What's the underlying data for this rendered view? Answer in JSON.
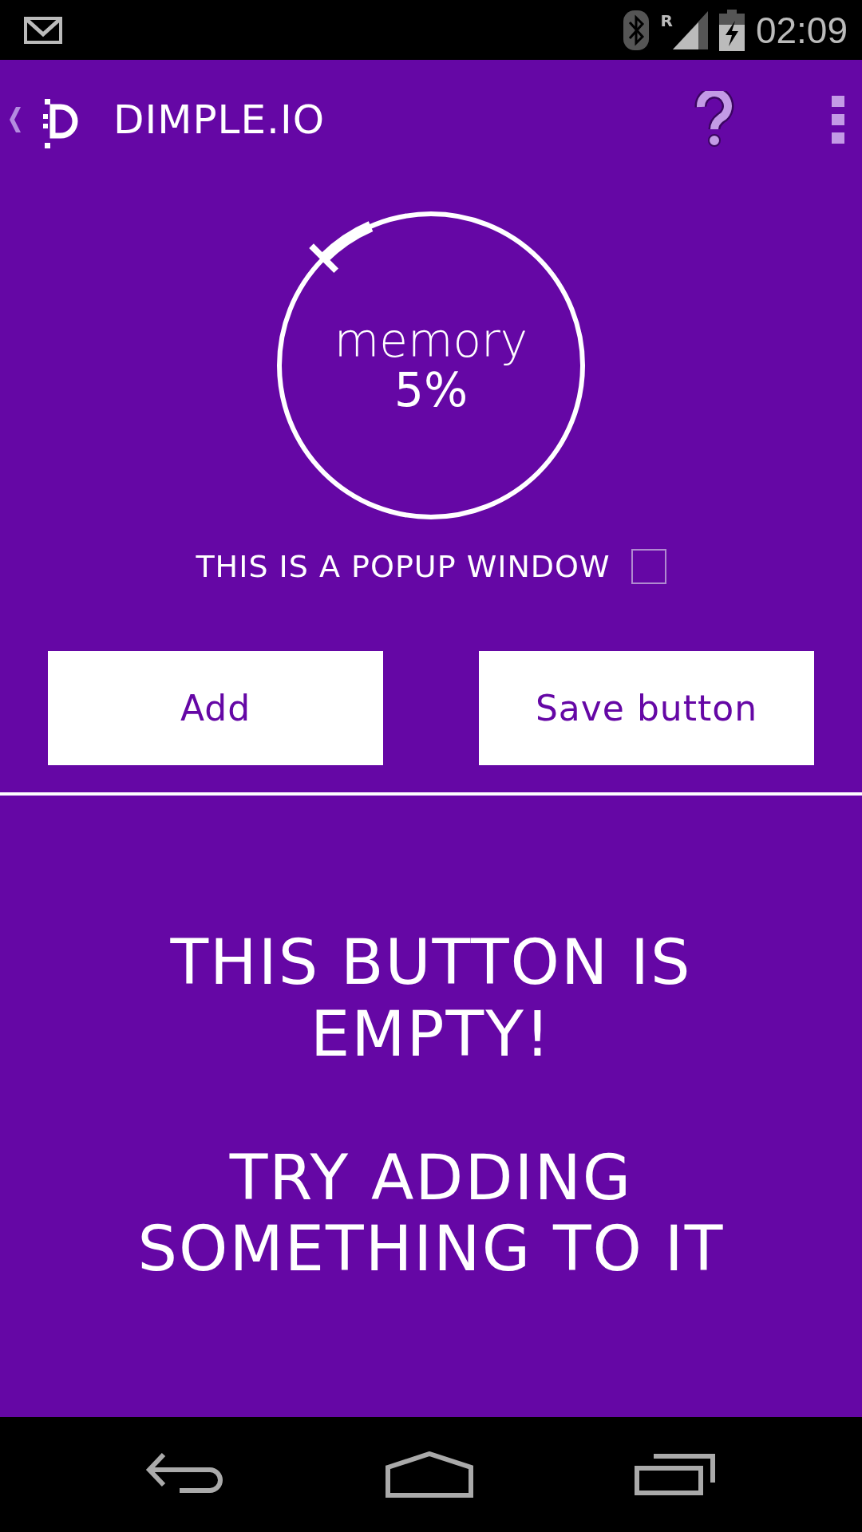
{
  "status_bar": {
    "time": "02:09",
    "roaming": "R"
  },
  "app_bar": {
    "title": "DIMPLE.IO"
  },
  "gauge": {
    "label": "memory",
    "reading": "5%"
  },
  "popup_option": {
    "label": "THIS IS A POPUP WINDOW",
    "checked": false
  },
  "buttons": [
    "Add",
    "Save button"
  ],
  "empty_message": [
    "THIS BUTTON IS EMPTY!",
    "TRY ADDING SOMETHING TO IT"
  ]
}
